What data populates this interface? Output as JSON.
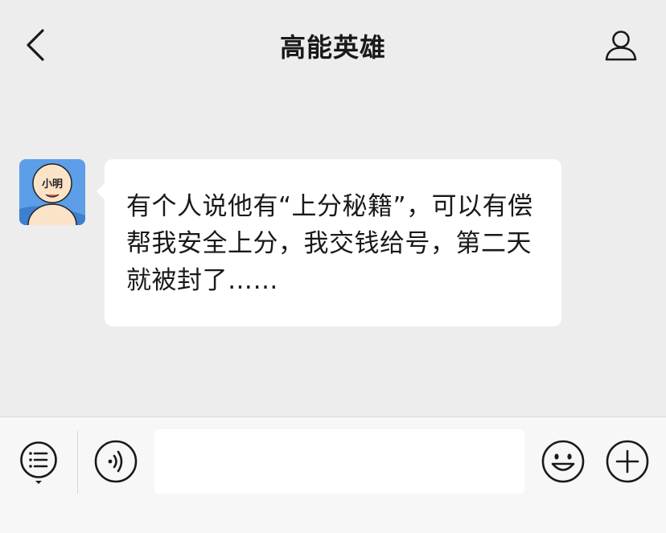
{
  "header": {
    "title": "高能英雄",
    "back_icon": "chevron-left-icon",
    "profile_icon": "person-outline-icon"
  },
  "messages": [
    {
      "sender_avatar_text": "小明",
      "text": "有个人说他有“上分秘籍”，可以有偿帮我安全上分，我交钱给号，第二天就被封了……"
    }
  ],
  "input_bar": {
    "menu_icon": "list-menu-icon",
    "voice_icon": "voice-icon",
    "input_value": "",
    "emoji_icon": "smiley-icon",
    "plus_icon": "plus-circle-icon"
  },
  "colors": {
    "background": "#ededed",
    "bubble": "#ffffff",
    "bottom_bar": "#f7f7f7",
    "text": "#191919",
    "avatar_bg": "#4a90e2"
  }
}
